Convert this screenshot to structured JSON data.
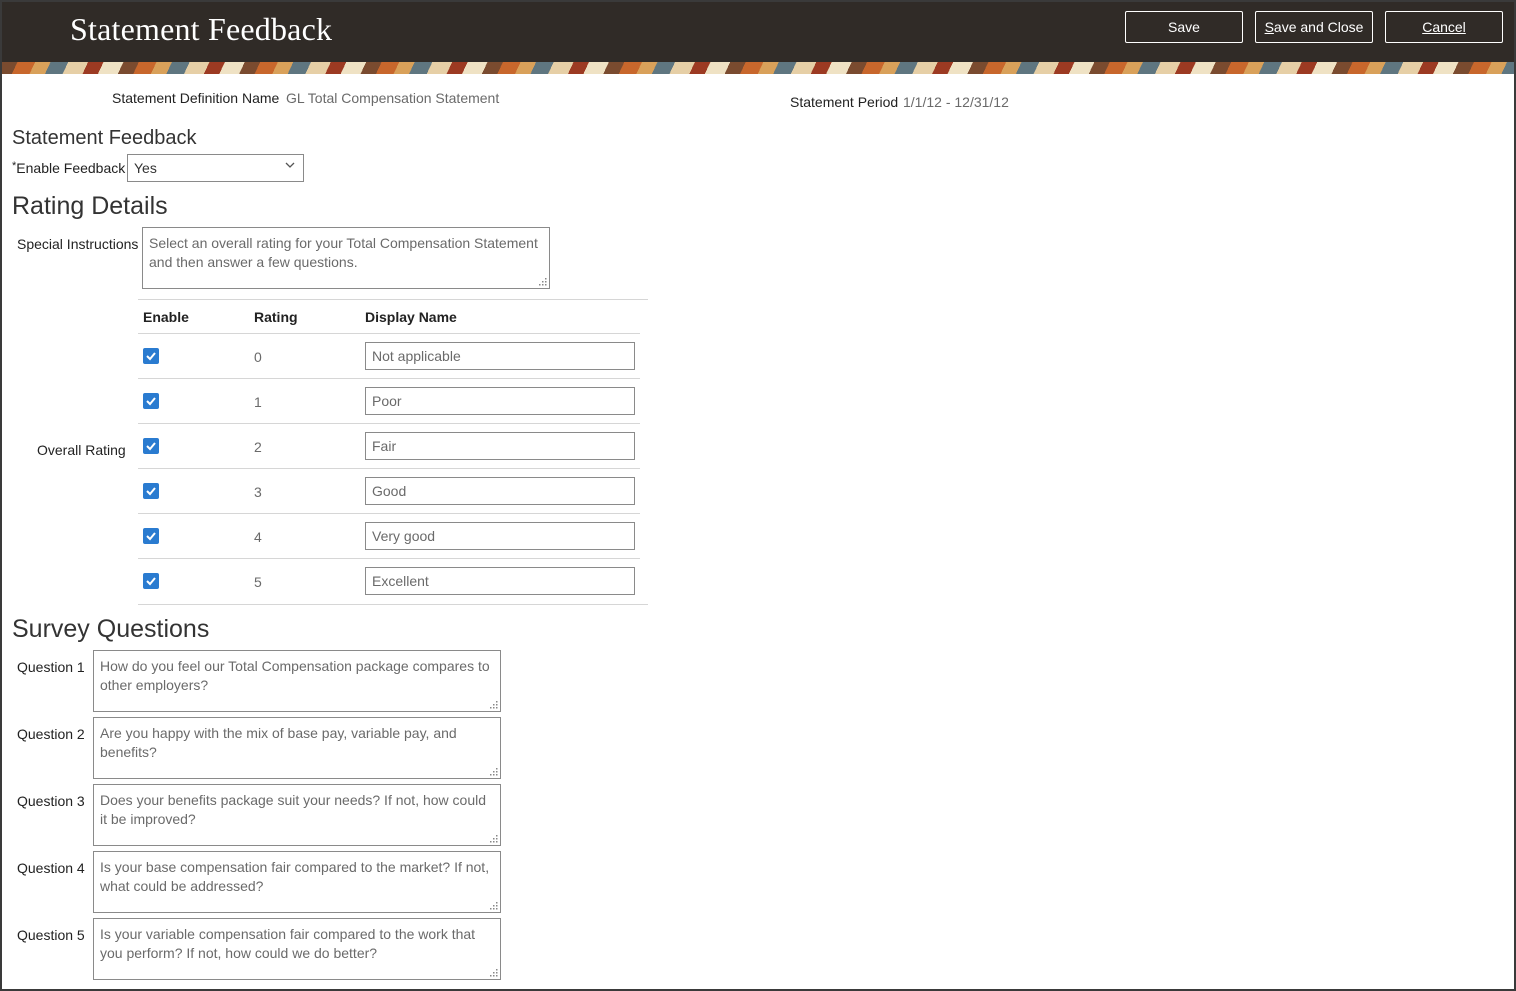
{
  "header": {
    "title": "Statement Feedback",
    "buttons": {
      "save": "Save",
      "save_close": "Save and Close",
      "cancel": "Cancel"
    }
  },
  "info": {
    "definition_label": "Statement Definition Name",
    "definition_value": "GL Total Compensation Statement",
    "period_label": "Statement Period",
    "period_value": "1/1/12 - 12/31/12"
  },
  "feedback": {
    "section_title": "Statement Feedback",
    "enable_required": "*",
    "enable_label": "Enable Feedback",
    "enable_value": "Yes"
  },
  "rating": {
    "section_title": "Rating Details",
    "instructions_label": "Special Instructions",
    "instructions_value": "Select an overall rating for your Total Compensation Statement and then answer a few questions.",
    "overall_label": "Overall Rating",
    "columns": {
      "enable": "Enable",
      "rating": "Rating",
      "display_name": "Display Name"
    },
    "rows": [
      {
        "enabled": true,
        "rating": "0",
        "display_name": "Not applicable"
      },
      {
        "enabled": true,
        "rating": "1",
        "display_name": "Poor"
      },
      {
        "enabled": true,
        "rating": "2",
        "display_name": "Fair"
      },
      {
        "enabled": true,
        "rating": "3",
        "display_name": "Good"
      },
      {
        "enabled": true,
        "rating": "4",
        "display_name": "Very good"
      },
      {
        "enabled": true,
        "rating": "5",
        "display_name": "Excellent"
      }
    ]
  },
  "survey": {
    "section_title": "Survey Questions",
    "questions": [
      {
        "label": "Question 1",
        "text": "How do you feel our Total Compensation package compares to other employers?"
      },
      {
        "label": "Question 2",
        "text": "Are you happy with the mix of base pay, variable pay, and benefits?"
      },
      {
        "label": "Question 3",
        "text": "Does your benefits package suit your needs? If not, how could it be improved?"
      },
      {
        "label": "Question 4",
        "text": "Is your base compensation fair compared to the market? If not, what could be addressed?"
      },
      {
        "label": "Question 5",
        "text": "Is your variable compensation fair compared to the work that you perform? If not, how could we do better?"
      }
    ]
  },
  "colors": {
    "header_bg": "#302b27",
    "checkbox": "#2a7bd0",
    "muted_text": "#6a6a6a"
  },
  "icons": {
    "dropdown": "chevron-down-icon",
    "checkbox": "checkmark-icon",
    "resize": "resize-grip-icon"
  }
}
